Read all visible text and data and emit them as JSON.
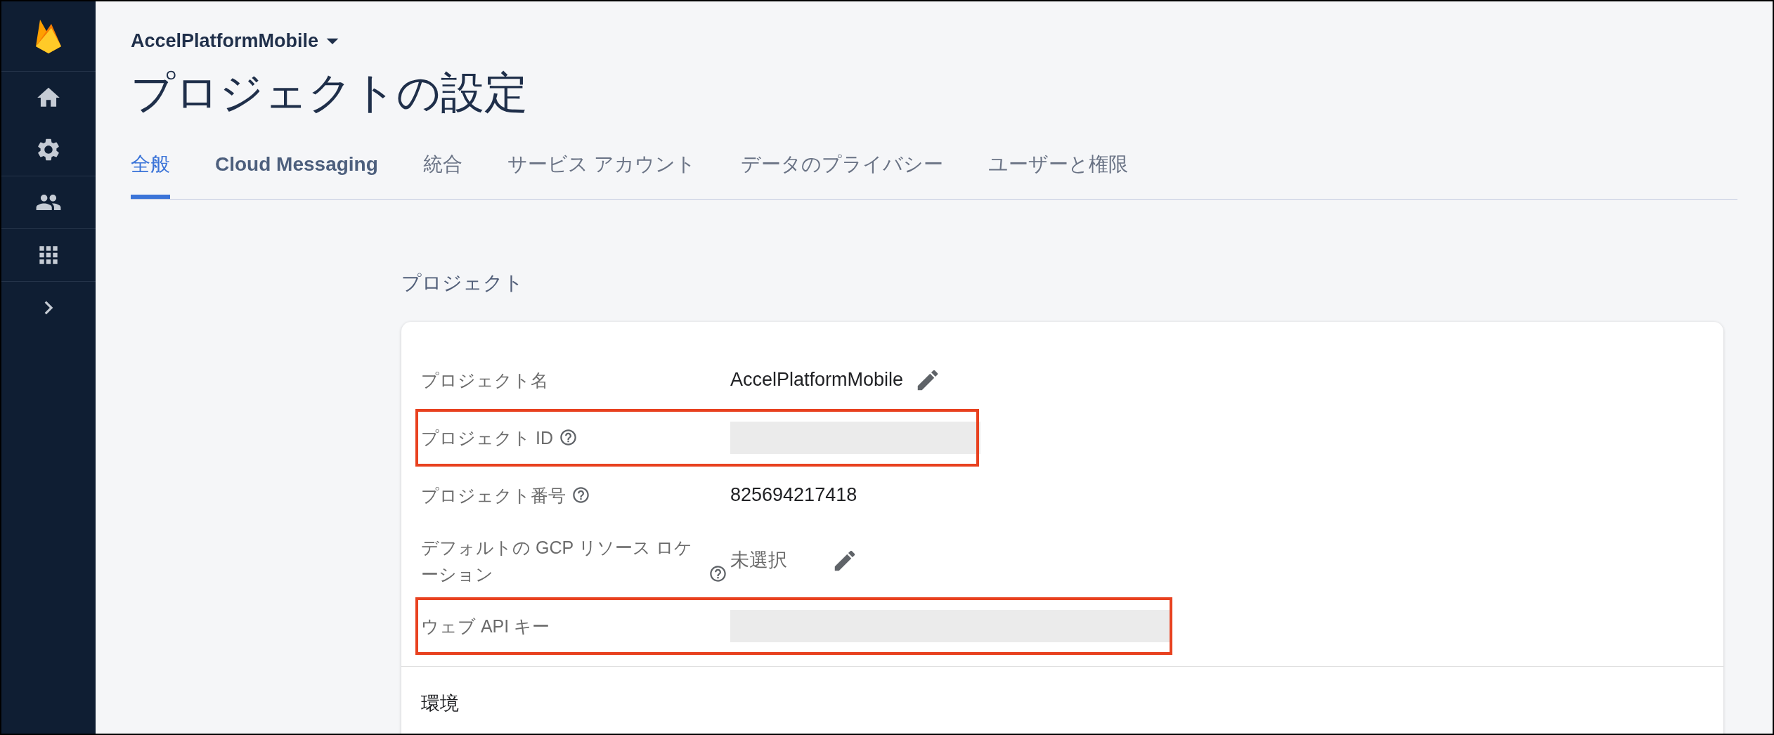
{
  "sidebar": {
    "items": [
      {
        "kind": "home",
        "selected": false
      },
      {
        "kind": "settings",
        "selected": false
      },
      {
        "kind": "users",
        "selected": false
      },
      {
        "kind": "apps",
        "selected": false
      },
      {
        "kind": "expand",
        "selected": false
      }
    ]
  },
  "header": {
    "project": "AccelPlatformMobile",
    "title": "プロジェクトの設定"
  },
  "tabs": [
    {
      "label": "全般",
      "selected": true
    },
    {
      "label": "Cloud Messaging",
      "selected": false
    },
    {
      "label": "統合",
      "selected": false
    },
    {
      "label": "サービス アカウント",
      "selected": false
    },
    {
      "label": "データのプライバシー",
      "selected": false
    },
    {
      "label": "ユーザーと権限",
      "selected": false
    }
  ],
  "section_title": "プロジェクト",
  "rows": [
    {
      "label": "プロジェクト名",
      "help": false,
      "kind": "text",
      "value": "AccelPlatformMobile",
      "editable": true,
      "highlighted": false
    },
    {
      "label": "プロジェクト ID",
      "help": true,
      "kind": "redacted",
      "editable": false,
      "highlighted": true
    },
    {
      "label": "プロジェクト番号",
      "help": true,
      "kind": "text",
      "value": "825694217418",
      "editable": false,
      "highlighted": false
    },
    {
      "label": "デフォルトの GCP リソース ロケーション",
      "help": true,
      "kind": "muted",
      "value": "未選択",
      "editable": true,
      "highlighted": false
    },
    {
      "label": "ウェブ API キー",
      "help": false,
      "kind": "redacted_wide",
      "editable": false,
      "highlighted": true
    }
  ],
  "next_section": "環境"
}
